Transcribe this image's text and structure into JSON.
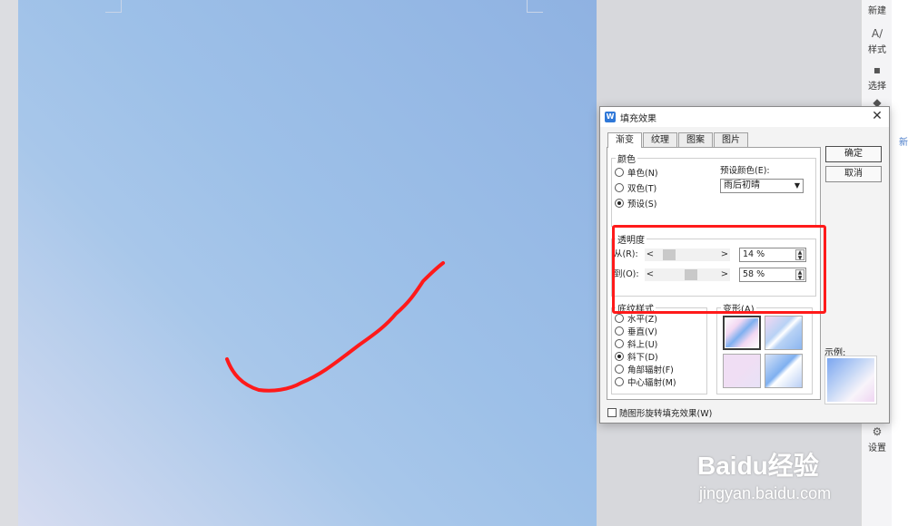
{
  "sidebar": {
    "items": [
      {
        "label": "新建",
        "icon": "new-icon"
      },
      {
        "label": "样式",
        "icon": "style-icon"
      },
      {
        "label": "选择",
        "icon": "select-icon"
      },
      {
        "label": "",
        "icon": "shape-icon"
      },
      {
        "label": "设置",
        "icon": "settings-icon"
      }
    ]
  },
  "far_right_text": "新",
  "dialog": {
    "title": "填充效果",
    "close_glyph": "✕",
    "tabs": [
      "渐变",
      "纹理",
      "图案",
      "图片"
    ],
    "active_tab": "渐变",
    "color_group": {
      "title": "颜色",
      "options": [
        "单色(N)",
        "双色(T)",
        "预设(S)"
      ],
      "selected": "预设(S)",
      "preset_label": "预设颜色(E):",
      "preset_value": "雨后初晴"
    },
    "transparency": {
      "title": "透明度",
      "from_label": "从(R):",
      "from_value": "14 %",
      "from_fraction": 0.14,
      "to_label": "到(O):",
      "to_value": "58 %",
      "to_fraction": 0.58,
      "left_arrow": "<",
      "right_arrow": ">"
    },
    "shading_styles": {
      "title": "底纹样式",
      "options": [
        "水平(Z)",
        "垂直(V)",
        "斜上(U)",
        "斜下(D)",
        "角部辐射(F)",
        "中心辐射(M)"
      ],
      "selected": "斜下(D)"
    },
    "variants": {
      "title": "变形(A)",
      "selected_index": 0
    },
    "ok_label": "确定",
    "cancel_label": "取消",
    "sample_label": "示例:",
    "rotate_label": "随图形旋转填充效果(W)",
    "rotate_checked": false
  },
  "watermark": {
    "brand": "Baidu经验",
    "url": "jingyan.baidu.com"
  },
  "colors": {
    "highlight": "#ff1a1a",
    "accent": "#2f78d8"
  }
}
